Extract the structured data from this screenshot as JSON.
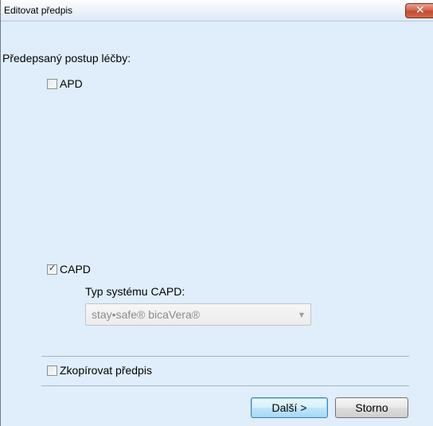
{
  "window": {
    "title": "Editovat předpis",
    "close_glyph": "✕"
  },
  "prescription": {
    "section_label": "Předepsaný postup léčby:",
    "apd": {
      "label": "APD",
      "checked": false
    },
    "capd": {
      "label": "CAPD",
      "checked": true,
      "system_type_label": "Typ systému CAPD:",
      "system_type_value": "stay•safe® bicaVera®",
      "enabled": false
    },
    "copy": {
      "label": "Zkopírovat předpis",
      "checked": false
    }
  },
  "footer": {
    "next_label": "Další >",
    "cancel_label": "Storno"
  },
  "icons": {
    "check_glyph": "✓",
    "dropdown_glyph": "▼"
  },
  "colors": {
    "dialog_background": "#dfeefa",
    "close_button": "#c9553a",
    "disabled_text": "#8c8c8c"
  }
}
